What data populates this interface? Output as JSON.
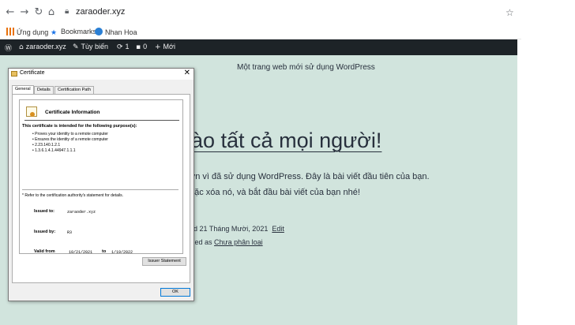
{
  "browser": {
    "url": "zaraoder.xyz",
    "bookmarks": [
      {
        "label": "Ứng dụng",
        "icon": "apps-icon"
      },
      {
        "label": "Bookmarks",
        "icon": "star-icon"
      },
      {
        "label": "Nhan Hoa",
        "icon": "site-icon"
      }
    ]
  },
  "wp_admin_bar": {
    "site_name": "zaraoder.xyz",
    "customize": "Tùy biến",
    "updates": "1",
    "comments": "0",
    "new": "Mới"
  },
  "page": {
    "tagline": "Một trang web mới sử dụng WordPress",
    "post_title": "ào tất cả mọi người!",
    "p1": "ợn vì đã sử dụng WordPress. Đây là bài viết đầu tiên của bạn.",
    "p2": "oặc xóa nó, và bắt đầu bài viết của bạn nhé!",
    "meta1_prefix": "ed 21 Tháng Mười, 2021",
    "meta1_link": "Edit",
    "meta2_prefix": "ized as",
    "meta2_link": "Chưa phân loại"
  },
  "certificate": {
    "window_title": "Certificate",
    "tabs": [
      "General",
      "Details",
      "Certification Path"
    ],
    "info_title": "Certificate Information",
    "purpose_heading": "This certificate is intended for the following purpose(s):",
    "purposes": [
      "• Proves your identity to a remote computer",
      "• Ensures the identity of a remote computer",
      "• 2.23.140.1.2.1",
      "• 1.3.6.1.4.1.44947.1.1.1"
    ],
    "refer_note": "* Refer to the certification authority's statement for details.",
    "issued_to_label": "Issued to:",
    "issued_to": "zaraoder.xyz",
    "issued_by_label": "Issued by:",
    "issued_by": "R3",
    "valid_from_label": "Valid from",
    "valid_from": "10/21/2021",
    "valid_to_label": "to",
    "valid_to": "1/19/2022",
    "issuer_statement_button": "Issuer Statement",
    "ok_button": "OK"
  }
}
